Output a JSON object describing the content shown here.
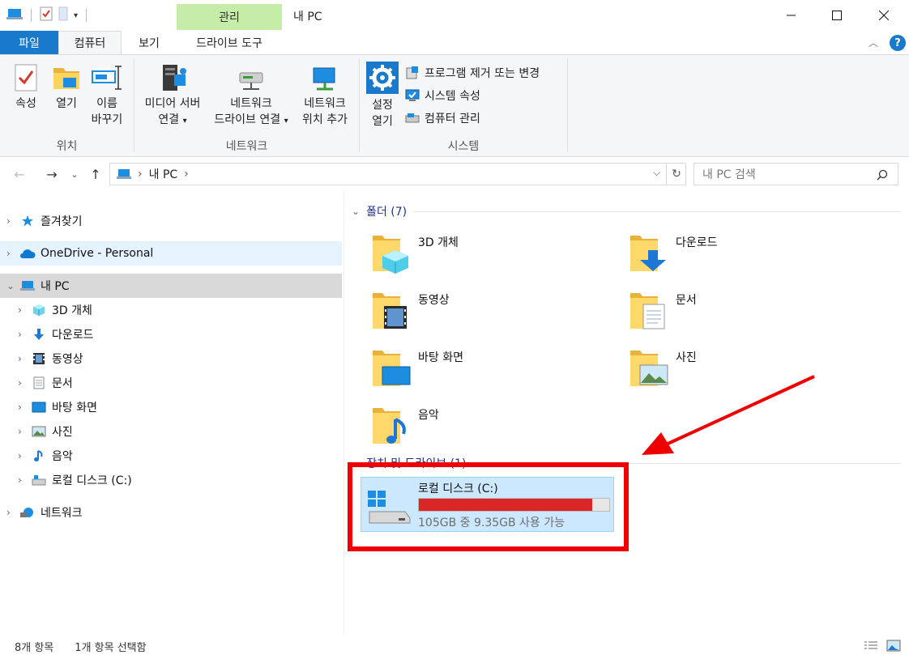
{
  "window": {
    "title": "내 PC",
    "context_tab": "관리",
    "controls": {
      "minimize": "minimize-icon",
      "maximize": "maximize-icon",
      "close": "close-icon"
    }
  },
  "tabs": [
    {
      "label": "파일"
    },
    {
      "label": "컴퓨터"
    },
    {
      "label": "보기"
    },
    {
      "label": "드라이브 도구"
    }
  ],
  "ribbon": {
    "location": {
      "label": "위치",
      "buttons": [
        {
          "line1": "속성",
          "line2": "",
          "icon": "properties-icon"
        },
        {
          "line1": "열기",
          "line2": "",
          "icon": "open-folder-icon"
        },
        {
          "line1": "이름",
          "line2": "바꾸기",
          "icon": "rename-icon"
        }
      ]
    },
    "network": {
      "label": "네트워크",
      "buttons": [
        {
          "line1": "미디어 서버",
          "line2": "연결",
          "dropdown": true,
          "icon": "media-server-icon"
        },
        {
          "line1": "네트워크",
          "line2": "드라이브 연결",
          "dropdown": true,
          "icon": "network-drive-icon"
        },
        {
          "line1": "네트워크",
          "line2": "위치 추가",
          "dropdown": false,
          "icon": "network-location-icon"
        }
      ]
    },
    "system": {
      "label": "시스템",
      "settings": {
        "line1": "설정",
        "line2": "열기",
        "icon": "gear-icon"
      },
      "items": [
        {
          "label": "프로그램 제거 또는 변경",
          "icon": "uninstall-icon"
        },
        {
          "label": "시스템 속성",
          "icon": "system-properties-icon"
        },
        {
          "label": "컴퓨터 관리",
          "icon": "computer-management-icon"
        }
      ]
    }
  },
  "address": {
    "path": [
      "내 PC"
    ],
    "search_placeholder": "내 PC 검색"
  },
  "nav_pane": {
    "items": [
      {
        "label": "즐겨찾기",
        "icon": "star-icon",
        "level": 0
      },
      {
        "label": "OneDrive - Personal",
        "icon": "cloud-icon",
        "level": 0,
        "highlight": true
      },
      {
        "label": "내 PC",
        "icon": "pc-icon",
        "level": 0,
        "selected": true,
        "expanded": true
      },
      {
        "label": "3D 개체",
        "icon": "cube-icon",
        "level": 1
      },
      {
        "label": "다운로드",
        "icon": "download-icon",
        "level": 1
      },
      {
        "label": "동영상",
        "icon": "video-icon",
        "level": 1
      },
      {
        "label": "문서",
        "icon": "document-icon",
        "level": 1
      },
      {
        "label": "바탕 화면",
        "icon": "desktop-icon",
        "level": 1
      },
      {
        "label": "사진",
        "icon": "picture-icon",
        "level": 1
      },
      {
        "label": "음악",
        "icon": "music-icon",
        "level": 1
      },
      {
        "label": "로컬 디스크 (C:)",
        "icon": "drive-icon",
        "level": 1
      },
      {
        "label": "네트워크",
        "icon": "network-icon",
        "level": 0
      }
    ]
  },
  "content": {
    "folders_header": "폴더 (7)",
    "folders": [
      {
        "label": "3D 개체",
        "icon": "cube-icon"
      },
      {
        "label": "다운로드",
        "icon": "download-icon"
      },
      {
        "label": "동영상",
        "icon": "video-icon"
      },
      {
        "label": "문서",
        "icon": "document-icon"
      },
      {
        "label": "바탕 화면",
        "icon": "desktop-icon"
      },
      {
        "label": "사진",
        "icon": "picture-icon"
      },
      {
        "label": "음악",
        "icon": "music-icon"
      }
    ],
    "drives_header": "장치 및 드라이브 (1)",
    "drive": {
      "name": "로컬 디스크 (C:)",
      "space_text": "105GB 중 9.35GB 사용 가능",
      "used_fraction": 0.911
    }
  },
  "status": {
    "count": "8개 항목",
    "selection": "1개 항목 선택함"
  },
  "colors": {
    "accent": "#1979ca",
    "context_tab": "#c6eda7",
    "drive_bar": "#da2626",
    "annotation": "#e00000"
  }
}
